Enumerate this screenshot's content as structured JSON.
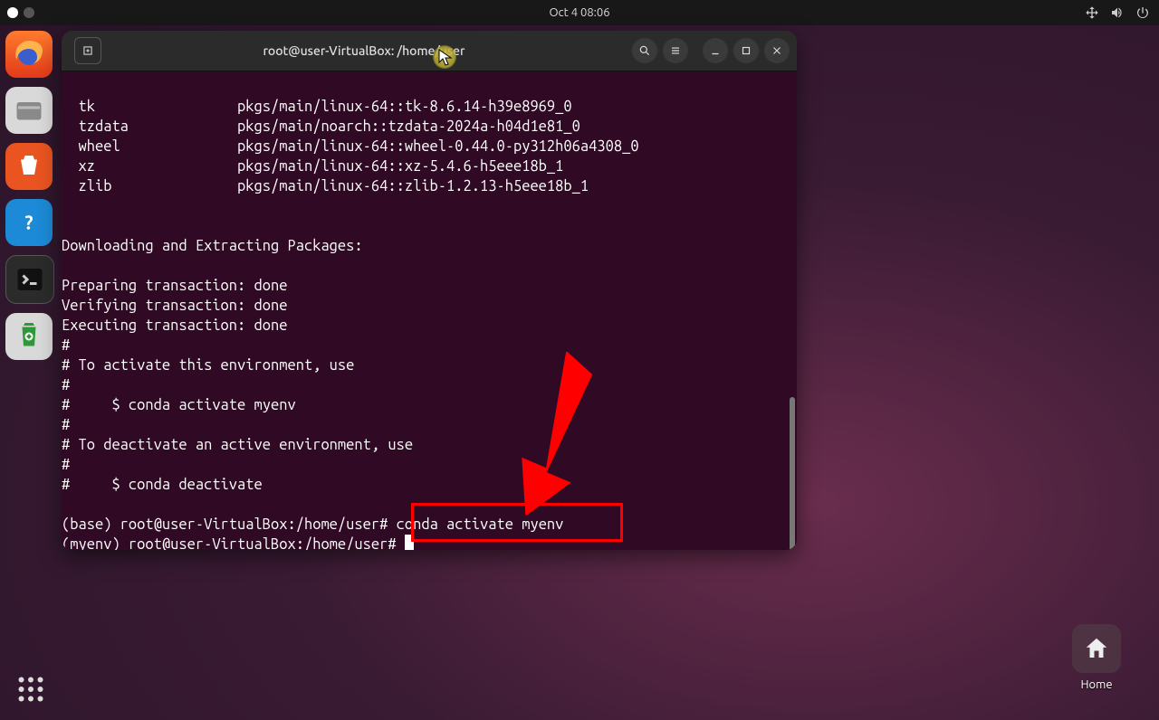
{
  "menubar": {
    "clock": "Oct 4  08:06"
  },
  "dock": {
    "items": [
      {
        "name": "firefox"
      },
      {
        "name": "files"
      },
      {
        "name": "software"
      },
      {
        "name": "help"
      },
      {
        "name": "terminal"
      },
      {
        "name": "trash"
      }
    ]
  },
  "terminal": {
    "title": "root@user-VirtualBox: /home/user",
    "pkg_lines": [
      "  tk                 pkgs/main/linux-64::tk-8.6.14-h39e8969_0",
      "  tzdata             pkgs/main/noarch::tzdata-2024a-h04d1e81_0",
      "  wheel              pkgs/main/linux-64::wheel-0.44.0-py312h06a4308_0",
      "  xz                 pkgs/main/linux-64::xz-5.4.6-h5eee18b_1",
      "  zlib               pkgs/main/linux-64::zlib-1.2.13-h5eee18b_1"
    ],
    "body_lines": [
      "",
      "",
      "Downloading and Extracting Packages:",
      "",
      "Preparing transaction: done",
      "Verifying transaction: done",
      "Executing transaction: done",
      "#",
      "# To activate this environment, use",
      "#",
      "#     $ conda activate myenv",
      "#",
      "# To deactivate an active environment, use",
      "#",
      "#     $ conda deactivate",
      ""
    ],
    "prompt1": "(base) root@user-VirtualBox:/home/user#",
    "command1": " conda activate myenv",
    "prompt2": "(myenv) root@user-VirtualBox:/home/user# "
  },
  "desktop": {
    "home_label": "Home"
  }
}
